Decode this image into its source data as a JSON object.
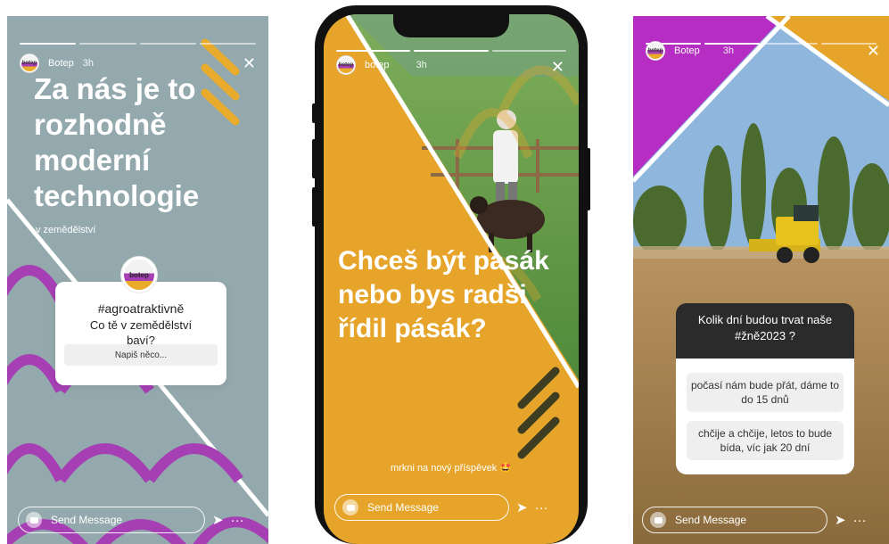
{
  "stories": [
    {
      "account": "Botep",
      "avatar_text": "botep",
      "time": "3h",
      "headline": "Za nás je to rozhodně moderní technologie",
      "subheadline": "v zemědělství",
      "question_card": {
        "avatar_text": "botep",
        "title": "#agroatraktivně",
        "question": "Co tě v zemědělství baví?",
        "answer_placeholder": "Napiš něco..."
      },
      "send_placeholder": "Send Message",
      "colors": {
        "background": "#94a9ad",
        "accent_purple": "#a63fb4",
        "accent_yellow": "#e9ab2c"
      }
    },
    {
      "account": "botep",
      "avatar_text": "botep",
      "time": "3h",
      "headline": "Chceš být pasák nebo bys radši řídil pásák?",
      "footer": "mrkni na nový příspěvek",
      "footer_emoji": "🤩",
      "send_placeholder": "Send Message",
      "colors": {
        "background": "#e6a52a",
        "accent_dark": "#3d3d22"
      }
    },
    {
      "account": "Botep",
      "avatar_text": "botep",
      "time": "3h",
      "quiz": {
        "question": "Kolik dní budou trvat naše #žně2023 ?",
        "answers": [
          "počasí nám bude přát, dáme to do 15 dnů",
          "chčije a chčije, letos to bude bída, víc jak 20 dní"
        ]
      },
      "send_placeholder": "Send Message",
      "colors": {
        "accent_purple": "#b52dc2",
        "accent_yellow": "#e6a52a",
        "sky": "#8fb6dd"
      }
    }
  ],
  "icons": {
    "close": "close-icon",
    "send": "send-icon",
    "more": "more-icon",
    "camera": "camera-icon"
  }
}
